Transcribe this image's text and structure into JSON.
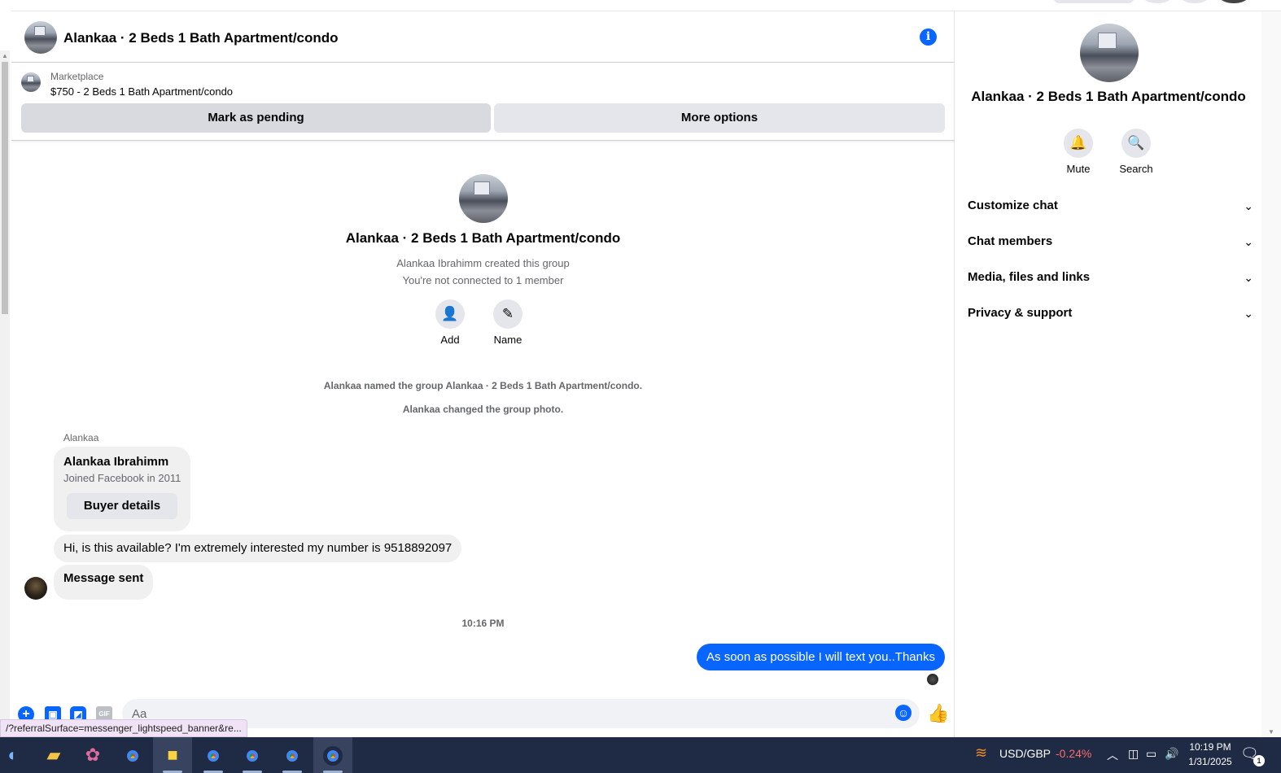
{
  "chat": {
    "title": "Alankaa · 2 Beds 1 Bath Apartment/condo",
    "marketplace_label": "Marketplace",
    "listing": "$750 - 2 Beds 1 Bath Apartment/condo",
    "mark_pending_label": "Mark as pending",
    "more_options_label": "More options"
  },
  "intro": {
    "title": "Alankaa · 2 Beds 1 Bath Apartment/condo",
    "created_by": "Alankaa Ibrahimm created this group",
    "connection": "You're not connected to 1 member",
    "add_label": "Add",
    "name_label": "Name"
  },
  "system_messages": [
    "Alankaa named the group Alankaa · 2 Beds 1 Bath Apartment/condo.",
    "Alankaa changed the group photo."
  ],
  "messages": {
    "sender": "Alankaa",
    "card_name": "Alankaa Ibrahimm",
    "card_sub": "Joined Facebook in 2011",
    "card_button": "Buyer details",
    "msg1": "Hi, is this available? I'm extremely interested my number is 9518892097",
    "msg2": "Message sent",
    "timestamp": "10:16 PM",
    "mine": "As soon as possible I will text you..Thanks"
  },
  "composer": {
    "placeholder": "Aa",
    "gif_label": "GIF"
  },
  "status_url": "/?referralSurface=messenger_lightspeed_banner&re...",
  "sidebar": {
    "title": "Alankaa · 2 Beds 1 Bath Apartment/condo",
    "mute_label": "Mute",
    "search_label": "Search",
    "sections": [
      "Customize chat",
      "Chat members",
      "Media, files and links",
      "Privacy & support"
    ]
  },
  "taskbar": {
    "ticker_label": "USD/GBP",
    "ticker_value": "-0.24%",
    "time": "10:19 PM",
    "date": "1/31/2025",
    "notification_count": "1"
  },
  "colors": {
    "accent": "#0866ff",
    "taskbar": "#1f2a44"
  }
}
